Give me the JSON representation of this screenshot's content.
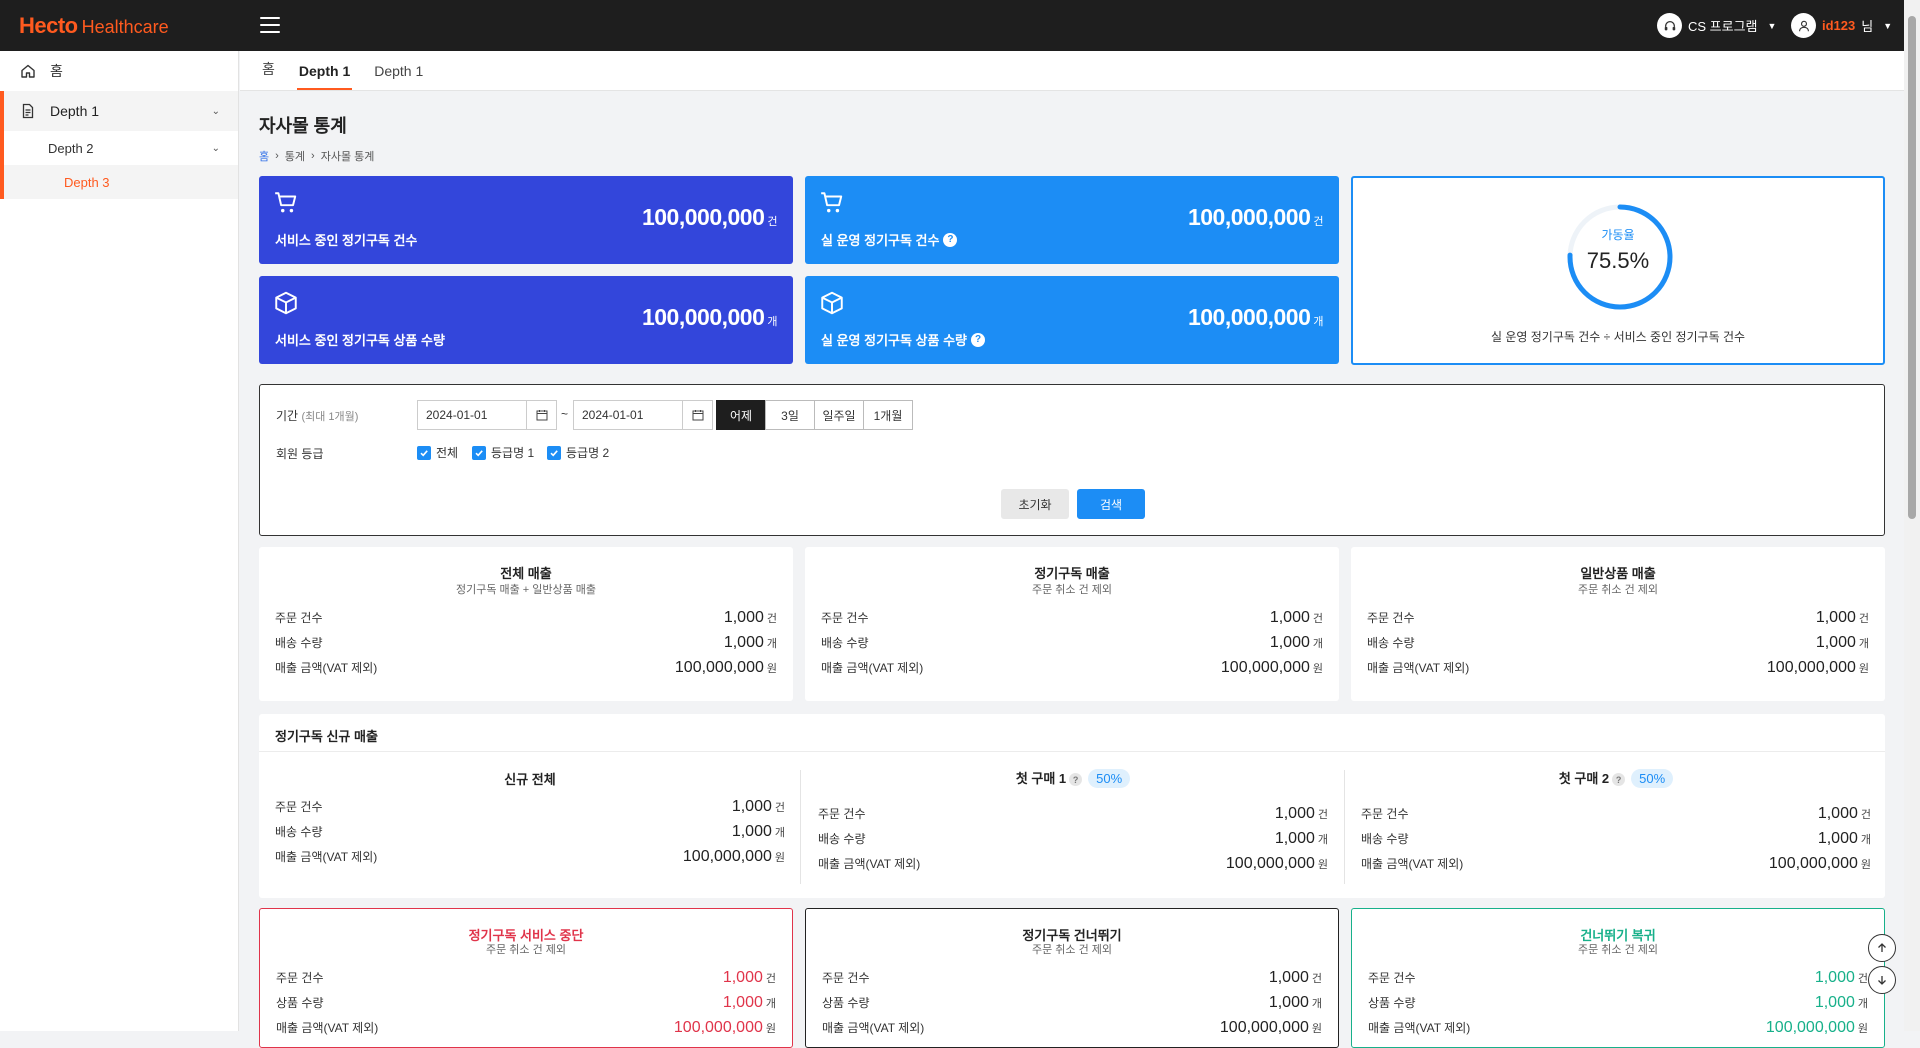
{
  "brand": {
    "mark": "Hecto",
    "word": "Healthcare"
  },
  "header": {
    "cs_label": "CS 프로그램",
    "user_id": "id123",
    "user_suffix": "님"
  },
  "sidebar": {
    "home": "홈",
    "depth1": "Depth 1",
    "depth2": "Depth 2",
    "depth3": "Depth 3"
  },
  "tabs": [
    {
      "label": "홈"
    },
    {
      "label": "Depth 1"
    },
    {
      "label": "Depth 1"
    }
  ],
  "page": {
    "title": "자사몰 통계",
    "breadcrumb": [
      "홈",
      "통계",
      "자사몰 통계"
    ]
  },
  "kpis": [
    {
      "label": "서비스 중인 정기구독 건수",
      "value": "100,000,000",
      "unit": "건",
      "icon": "cart-icon",
      "color": "#3346db"
    },
    {
      "label": "실 운영 정기구독 건수",
      "value": "100,000,000",
      "unit": "건",
      "icon": "cart-icon",
      "color": "#1c8df5",
      "help": "?"
    },
    {
      "label": "서비스 중인 정기구독 상품 수량",
      "value": "100,000,000",
      "unit": "개",
      "icon": "box-icon",
      "color": "#3346db"
    },
    {
      "label": "실 운영 정기구독 상품 수량",
      "value": "100,000,000",
      "unit": "개",
      "icon": "box-icon",
      "color": "#1c8df5",
      "help": "?"
    }
  ],
  "gauge": {
    "label": "가동율",
    "value_text": "75.5%",
    "value": 0.755,
    "desc": "실 운영 정기구독 건수 ÷ 서비스 중인 정기구독 건수",
    "color": "#1c8df5"
  },
  "filter": {
    "period_label": "기간",
    "period_hint": "(최대 1개월)",
    "date_from": "2024-01-01",
    "date_to": "2024-01-01",
    "tilde": "~",
    "ranges": [
      "어제",
      "3일",
      "일주일",
      "1개월"
    ],
    "range_selected": "어제",
    "grade_label": "회원 등급",
    "grades": [
      "전체",
      "등급명 1",
      "등급명 2"
    ],
    "reset_label": "초기화",
    "search_label": "검색"
  },
  "sales_cards": [
    {
      "title": "전체 매출",
      "sub": "정기구독 매출 + 일반상품 매출",
      "rows": [
        {
          "label": "주문 건수",
          "value": "1,000",
          "unit": "건"
        },
        {
          "label": "배송 수량",
          "value": "1,000",
          "unit": "개"
        },
        {
          "label": "매출 금액(VAT 제외)",
          "value": "100,000,000",
          "unit": "원"
        }
      ]
    },
    {
      "title": "정기구독 매출",
      "sub": "주문 취소 건 제외",
      "rows": [
        {
          "label": "주문 건수",
          "value": "1,000",
          "unit": "건"
        },
        {
          "label": "배송 수량",
          "value": "1,000",
          "unit": "개"
        },
        {
          "label": "매출 금액(VAT 제외)",
          "value": "100,000,000",
          "unit": "원"
        }
      ]
    },
    {
      "title": "일반상품 매출",
      "sub": "주문 취소 건 제외",
      "rows": [
        {
          "label": "주문 건수",
          "value": "1,000",
          "unit": "건"
        },
        {
          "label": "배송 수량",
          "value": "1,000",
          "unit": "개"
        },
        {
          "label": "매출 금액(VAT 제외)",
          "value": "100,000,000",
          "unit": "원"
        }
      ]
    }
  ],
  "new_sales": {
    "title": "정기구독 신규 매출",
    "cols": [
      {
        "title": "신규 전체",
        "rows": [
          {
            "label": "주문 건수",
            "value": "1,000",
            "unit": "건"
          },
          {
            "label": "배송 수량",
            "value": "1,000",
            "unit": "개"
          },
          {
            "label": "매출 금액(VAT 제외)",
            "value": "100,000,000",
            "unit": "원"
          }
        ]
      },
      {
        "title": "첫 구매 1",
        "help": "?",
        "badge": "50%",
        "rows": [
          {
            "label": "주문 건수",
            "value": "1,000",
            "unit": "건"
          },
          {
            "label": "배송 수량",
            "value": "1,000",
            "unit": "개"
          },
          {
            "label": "매출 금액(VAT 제외)",
            "value": "100,000,000",
            "unit": "원"
          }
        ]
      },
      {
        "title": "첫 구매 2",
        "help": "?",
        "badge": "50%",
        "rows": [
          {
            "label": "주문 건수",
            "value": "1,000",
            "unit": "건"
          },
          {
            "label": "배송 수량",
            "value": "1,000",
            "unit": "개"
          },
          {
            "label": "매출 금액(VAT 제외)",
            "value": "100,000,000",
            "unit": "원"
          }
        ]
      }
    ]
  },
  "status_cards": [
    {
      "title": "정기구독 서비스 중단",
      "sub": "주문 취소 건 제외",
      "color": "#e0344a",
      "rows": [
        {
          "label": "주문 건수",
          "value": "1,000",
          "unit": "건"
        },
        {
          "label": "상품 수량",
          "value": "1,000",
          "unit": "개"
        },
        {
          "label": "매출 금액(VAT 제외)",
          "value": "100,000,000",
          "unit": "원"
        }
      ]
    },
    {
      "title": "정기구독 건너뛰기",
      "sub": "주문 취소 건 제외",
      "color": "#222222",
      "rows": [
        {
          "label": "주문 건수",
          "value": "1,000",
          "unit": "건"
        },
        {
          "label": "상품 수량",
          "value": "1,000",
          "unit": "개"
        },
        {
          "label": "매출 금액(VAT 제외)",
          "value": "100,000,000",
          "unit": "원"
        }
      ]
    },
    {
      "title": "건너뛰기 복귀",
      "sub": "주문 취소 건 제외",
      "color": "#17b08a",
      "rows": [
        {
          "label": "주문 건수",
          "value": "1,000",
          "unit": "건"
        },
        {
          "label": "상품 수량",
          "value": "1,000",
          "unit": "개"
        },
        {
          "label": "매출 금액(VAT 제외)",
          "value": "100,000,000",
          "unit": "원"
        }
      ]
    }
  ]
}
